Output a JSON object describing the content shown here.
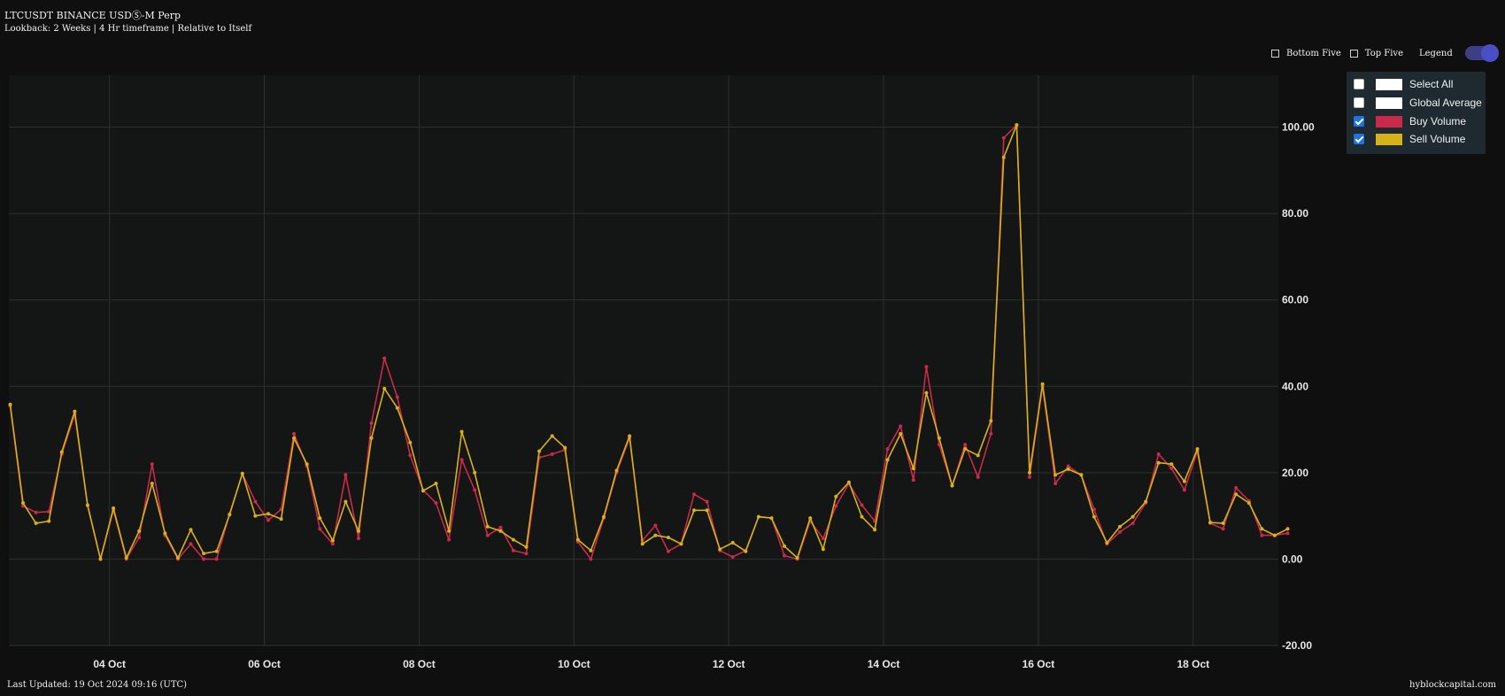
{
  "header": {
    "title": "LTCUSDT BINANCE USDⓈ-M Perp",
    "subtitle": "Lookback: 2 Weeks | 4 Hr timeframe | Relative to Itself"
  },
  "controls": {
    "bottom_five": "Bottom Five",
    "top_five": "Top Five",
    "legend": "Legend",
    "legend_toggle_on": true
  },
  "legend_panel": {
    "items": [
      {
        "label": "Select All",
        "checked": false,
        "color": "#ffffff"
      },
      {
        "label": "Global Average",
        "checked": false,
        "color": "#ffffff"
      },
      {
        "label": "Buy Volume",
        "checked": true,
        "color": "#c9294a"
      },
      {
        "label": "Sell Volume",
        "checked": true,
        "color": "#d6b21a"
      }
    ]
  },
  "footer": {
    "last_updated": "Last Updated: 19 Oct 2024 09:16 (UTC)",
    "brand": "hyblockcapital.com"
  },
  "chart_data": {
    "type": "line",
    "x_unit": "day",
    "x_start": "02 Oct",
    "x_step": 0.1667,
    "x_range_days": [
      2.7,
      19.1
    ],
    "x_ticks": [
      {
        "label": "04 Oct",
        "day": 4
      },
      {
        "label": "06 Oct",
        "day": 6
      },
      {
        "label": "08 Oct",
        "day": 8
      },
      {
        "label": "10 Oct",
        "day": 10
      },
      {
        "label": "12 Oct",
        "day": 12
      },
      {
        "label": "14 Oct",
        "day": 14
      },
      {
        "label": "16 Oct",
        "day": 16
      },
      {
        "label": "18 Oct",
        "day": 18
      }
    ],
    "y_ticks": [
      "100.00",
      "80.00",
      "60.00",
      "40.00",
      "20.00",
      "0.00",
      "-20.00"
    ],
    "ylim": [
      -20,
      112
    ],
    "grid": true,
    "series": [
      {
        "name": "Buy Volume",
        "color": "#c9294a",
        "values": [
          35.5,
          12.3,
          10.8,
          11,
          24.3,
          33.5,
          12.4,
          0,
          11.3,
          0,
          5,
          22,
          5.5,
          0,
          3.5,
          0,
          0,
          10.5,
          19.8,
          13.3,
          9,
          11.5,
          29,
          21.5,
          7,
          3.5,
          19.5,
          4.8,
          31.5,
          46.5,
          37.5,
          24,
          16,
          13,
          4.5,
          23,
          16,
          5.5,
          7.3,
          2,
          1.3,
          23.5,
          24.3,
          25.3,
          4,
          0,
          9.5,
          20,
          28,
          4.3,
          7.8,
          1.8,
          3.5,
          15,
          13.3,
          2,
          0.5,
          2,
          9.8,
          9.5,
          0.8,
          0,
          8.8,
          4.8,
          12.3,
          17.5,
          12.5,
          8.8,
          25.5,
          30.8,
          18.3,
          44.5,
          26.5,
          17,
          26.5,
          19,
          29,
          97.5,
          100.5,
          19,
          40,
          17.5,
          21.5,
          19.5,
          11.5,
          3.5,
          6.3,
          8.3,
          13,
          24.3,
          21,
          16,
          25,
          8.3,
          7,
          16.5,
          13.5,
          5.5,
          5.5,
          6
        ]
      },
      {
        "name": "Sell Volume",
        "color": "#d6b21a",
        "values": [
          35.8,
          13,
          8.3,
          8.8,
          24.8,
          34.2,
          12.5,
          0,
          11.8,
          0.3,
          6.5,
          17.5,
          6,
          0.3,
          6.8,
          1.3,
          1.8,
          10.3,
          19.8,
          10,
          10.5,
          9.3,
          28,
          22,
          9.5,
          4.3,
          13.3,
          6.5,
          28,
          39.5,
          35,
          27,
          15.8,
          17.5,
          6.5,
          29.5,
          20,
          7.5,
          6.5,
          4.5,
          2.8,
          25,
          28.5,
          25.8,
          4.5,
          2,
          9.8,
          20.5,
          28.5,
          3.5,
          5.5,
          5,
          3.5,
          11.3,
          11.3,
          2.3,
          3.8,
          1.8,
          9.8,
          9.5,
          3,
          0.3,
          9.5,
          2.3,
          14.5,
          17.8,
          9.8,
          6.8,
          23,
          29,
          21,
          38.5,
          28,
          17,
          25.5,
          24,
          32,
          93,
          100.5,
          20,
          40.5,
          19.5,
          20.8,
          19.5,
          9.8,
          3.8,
          7.5,
          9.8,
          13.3,
          22.3,
          22,
          18,
          25.5,
          8.5,
          8.3,
          15,
          13,
          7,
          5.5,
          7
        ]
      }
    ]
  }
}
